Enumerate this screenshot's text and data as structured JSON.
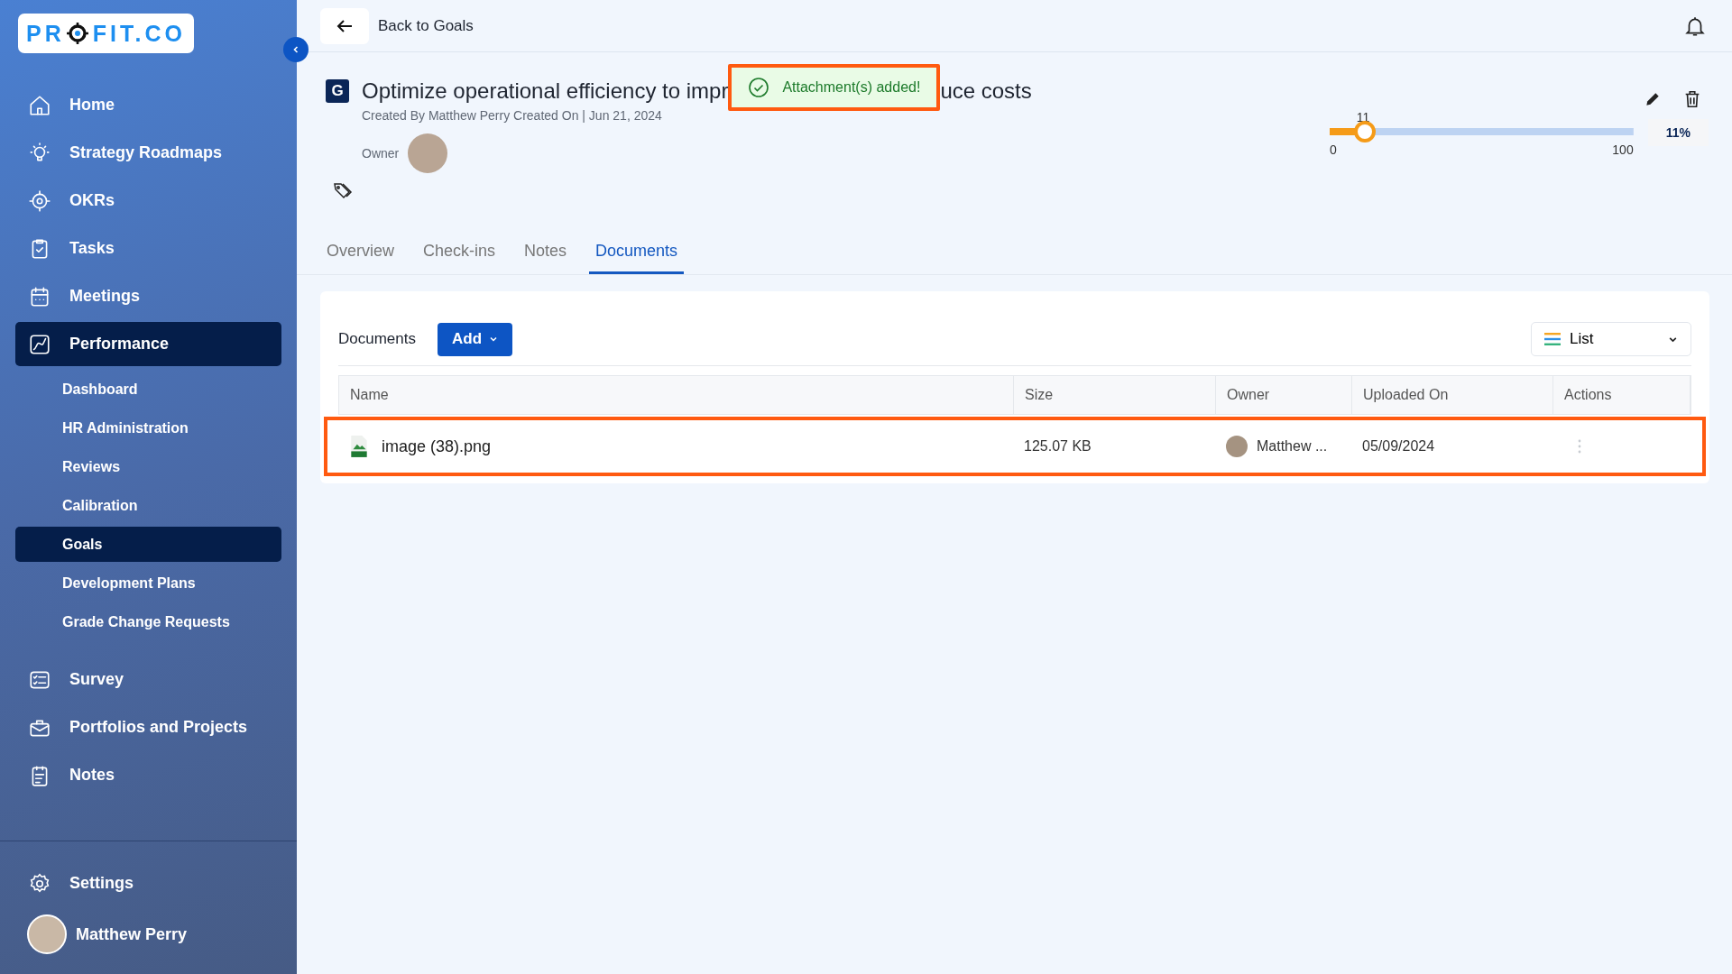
{
  "sidebar": {
    "logo_start": "PR",
    "logo_end": "FIT.CO",
    "items": [
      {
        "label": "Home",
        "selected": false
      },
      {
        "label": "Strategy Roadmaps",
        "selected": false
      },
      {
        "label": "OKRs",
        "selected": false
      },
      {
        "label": "Tasks",
        "selected": false
      },
      {
        "label": "Meetings",
        "selected": false
      },
      {
        "label": "Performance",
        "selected": true,
        "children": [
          {
            "label": "Dashboard",
            "selected": false
          },
          {
            "label": "HR Administration",
            "selected": false
          },
          {
            "label": "Reviews",
            "selected": false
          },
          {
            "label": "Calibration",
            "selected": false
          },
          {
            "label": "Goals",
            "selected": true
          },
          {
            "label": "Development Plans",
            "selected": false
          },
          {
            "label": "Grade Change Requests",
            "selected": false
          }
        ]
      },
      {
        "label": "Survey",
        "selected": false
      },
      {
        "label": "Portfolios and Projects",
        "selected": false
      },
      {
        "label": "Notes",
        "selected": false
      }
    ],
    "settings": "Settings",
    "user": "Matthew Perry"
  },
  "topbar": {
    "back": "Back to Goals"
  },
  "goal": {
    "badge": "G",
    "title_start": "Optimize operational efficiency to impr",
    "title_end": "uce costs",
    "meta": "Created By Matthew Perry Created On | Jun 21, 2024",
    "owner_label": "Owner"
  },
  "toast": {
    "message": "Attachment(s) added!",
    "highlighted": true
  },
  "slider": {
    "level": 0.11,
    "value": "11",
    "min": "0",
    "max": "100",
    "percent": "11%"
  },
  "tabs": [
    {
      "label": "Overview",
      "selected": false
    },
    {
      "label": "Check-ins",
      "selected": false
    },
    {
      "label": "Notes",
      "selected": false
    },
    {
      "label": "Documents",
      "selected": true
    }
  ],
  "documents": {
    "title": "Documents",
    "add": "Add",
    "view": "List",
    "columns": [
      "Name",
      "Size",
      "Owner",
      "Uploaded On",
      "Actions"
    ],
    "rows": [
      {
        "name": "image (38).png",
        "size": "125.07 KB",
        "owner": "Matthew ...",
        "uploaded_on": "05/09/2024",
        "highlighted": true
      }
    ]
  }
}
